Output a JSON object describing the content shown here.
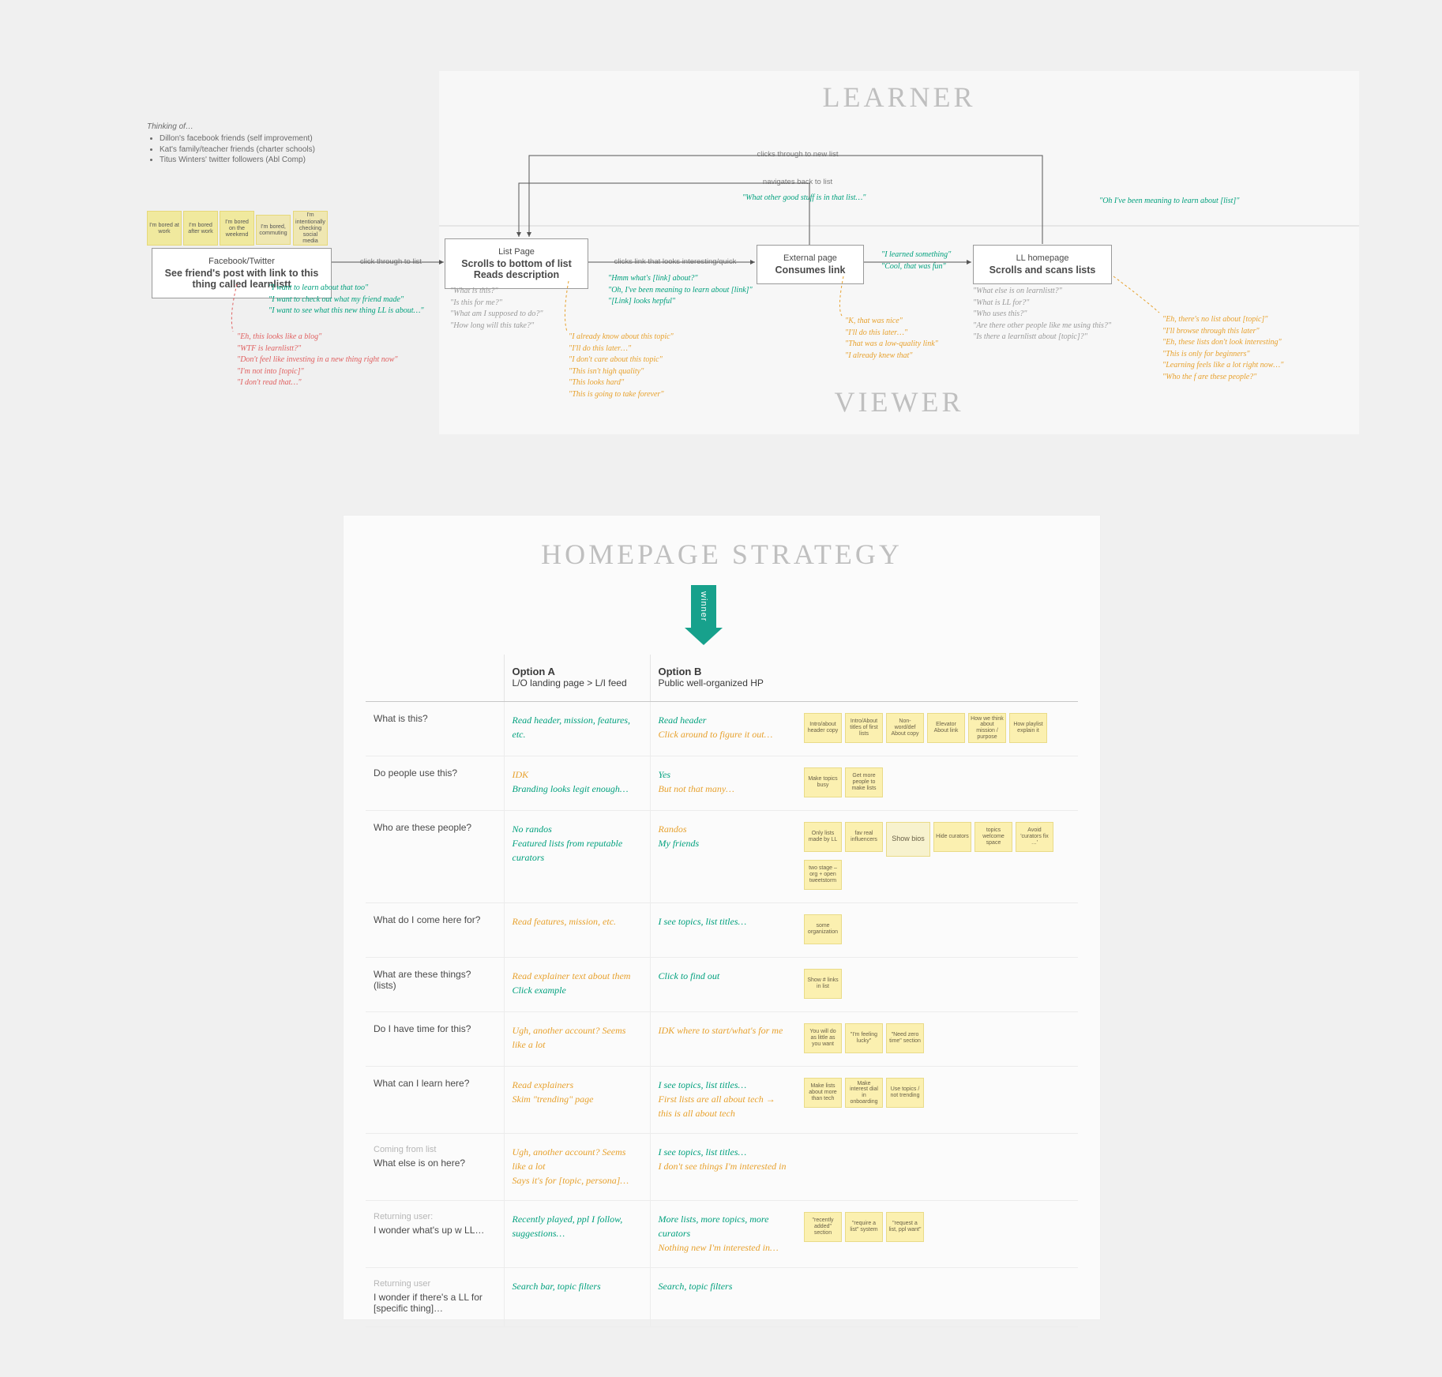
{
  "labels": {
    "learner": "LEARNER",
    "viewer": "Viewer",
    "strategy_title": "HOMEPAGE STRATEGY",
    "winner": "winner",
    "option_a": "Option A",
    "option_a_sub": "L/O landing page > L/I feed",
    "option_b": "Option B",
    "option_b_sub": "Public well-organized HP"
  },
  "thinking": {
    "head": "Thinking of…",
    "items": [
      "Dillon's facebook friends (self improvement)",
      "Kat's family/teacher friends (charter schools)",
      "Titus Winters' twitter followers (Abl Comp)"
    ]
  },
  "top_stickies": [
    "I'm bored at work",
    "I'm bored after work",
    "I'm bored on the weekend",
    "I'm bored, commuting",
    "I'm intentionally checking social media"
  ],
  "cards": {
    "fb": {
      "sub": "Facebook/Twitter",
      "title": "See friend's post with link to this thing called learnlistt"
    },
    "list": {
      "sub": "List Page",
      "title": "Scrolls to bottom of list\nReads description"
    },
    "ext": {
      "sub": "External page",
      "title": "Consumes link"
    },
    "hp": {
      "sub": "LL homepage",
      "title": "Scrolls and scans lists"
    }
  },
  "flow": {
    "click_list": "click through to list",
    "click_link": "clicks link that looks interesting/quick",
    "nav_back": "navigates back to list",
    "click_new": "clicks through to new list"
  },
  "quotes": {
    "fb_green": "\"I want to learn about that too\"\n\"I want to check out what my friend made\"\n\"I want to see what this new thing LL is about…\"",
    "fb_red": "\"Eh, this looks like a blog\"\n\"WTF is learnlistt?\"\n\"Don't feel like investing in a new thing right now\"\n\"I'm not into [topic]\"\n\"I don't read that…\"",
    "list_grey": "\"What is this?\"\n\"Is this for me?\"\n\"What am I supposed to do?\"\n\"How long will this take?\"",
    "list_green": "\"Hmm what's [link] about?\"\n\"Oh, I've been meaning to learn about [link]\"\n\"[Link] looks hepful\"",
    "list_orange": "\"I already know about this topic\"\n\"I'll do this later…\"\n\"I don't care about this topic\"\n\"This isn't high quality\"\n\"This looks hard\"\n\"This is going to take forever\"",
    "nav_green": "\"What other good stuff is in that list…\"",
    "ext_green_top": "\"I learned something\"\n\"Cool, that was fun\"",
    "ext_orange": "\"K, that was nice\"\n\"I'll do this later…\"\n\"That was a low-quality link\"\n\"I already knew that\"",
    "hp_green_intro": "\"Oh I've been meaning to learn about [list]\"",
    "hp_grey": "\"What else is on learnlistt?\"\n\"What is LL for?\"\n\"Who uses this?\"\n\"Are there other people like me using this?\"\n\"Is there a learnlistt about [topic]?\"",
    "hp_orange": "\"Eh, there's no list about [topic]\"\n\"I'll browse through this later\"\n\"Eh, these lists don't look interesting\"\n\"This is only for beginners\"\n\"Learning feels like a lot right now…\"\n\"Who the f are these people?\""
  },
  "strategy_rows": [
    {
      "question": "What is this?",
      "a": [
        [
          "green",
          "Read header, mission, features, etc."
        ]
      ],
      "b": [
        [
          "green",
          "Read header"
        ],
        [
          "orange",
          "Click around to figure it out…"
        ]
      ],
      "stickies": [
        "Intro/about header copy",
        "Intro/About titles of first lists",
        "Non-word/def About copy",
        "Elevator About link",
        "How we think about mission / purpose",
        "How playlist explain it"
      ]
    },
    {
      "question": "Do people use this?",
      "a": [
        [
          "orange",
          "IDK"
        ],
        [
          "green",
          "Branding looks legit enough…"
        ]
      ],
      "b": [
        [
          "green",
          "Yes"
        ],
        [
          "orange",
          "But not that many…"
        ]
      ],
      "stickies": [
        "Make topics busy",
        "Get more people to make lists"
      ]
    },
    {
      "question": "Who are these people?",
      "a": [
        [
          "green",
          "No randos"
        ],
        [
          "green",
          "Featured lists from reputable curators"
        ]
      ],
      "b": [
        [
          "orange",
          "Randos"
        ],
        [
          "green",
          "My friends"
        ]
      ],
      "stickies": [
        "Only lists made by LL",
        "fav real influencers",
        "Show bios",
        "Hide curators",
        "topics welcome space",
        "Avoid 'curators fix …'",
        "two stage – org + open tweetstorm"
      ]
    },
    {
      "question": "What do I come here for?",
      "a": [
        [
          "orange",
          "Read features, mission, etc."
        ]
      ],
      "b": [
        [
          "green",
          "I see topics, list titles…"
        ]
      ],
      "stickies": [
        "some organization"
      ]
    },
    {
      "question": "What are these things? (lists)",
      "a": [
        [
          "orange",
          "Read explainer text about them"
        ],
        [
          "green",
          "Click example"
        ]
      ],
      "b": [
        [
          "green",
          "Click to find out"
        ]
      ],
      "stickies": [
        "Show # links in list"
      ]
    },
    {
      "question": "Do I have time for this?",
      "a": [
        [
          "orange",
          "Ugh, another account? Seems like a lot"
        ]
      ],
      "b": [
        [
          "orange",
          "IDK where to start/what's for me"
        ]
      ],
      "stickies": [
        "You will do as little as you want",
        "\"I'm feeling lucky\"",
        "\"Need zero time\" section"
      ]
    },
    {
      "question": "What can I learn here?",
      "a": [
        [
          "orange",
          "Read explainers"
        ],
        [
          "orange",
          "Skim \"trending\" page"
        ]
      ],
      "b": [
        [
          "green",
          "I see topics, list titles…"
        ],
        [
          "orange",
          "First lists are all about tech → this is all about tech"
        ]
      ],
      "stickies": [
        "Make lists about more than tech",
        "Make interest dial in onboarding",
        "Use topics / not trending"
      ]
    },
    {
      "context": "Coming from list",
      "question": "What else is on here?",
      "a": [
        [
          "orange",
          "Ugh, another account? Seems like a lot"
        ],
        [
          "orange",
          "Says it's for [topic, persona]…"
        ]
      ],
      "b": [
        [
          "green",
          "I see topics, list titles…"
        ],
        [
          "orange",
          "I don't see things I'm interested in"
        ]
      ],
      "stickies": []
    },
    {
      "context": "Returning user:",
      "question": "I wonder what's up w LL…",
      "a": [
        [
          "green",
          "Recently played, ppl I follow, suggestions…"
        ]
      ],
      "b": [
        [
          "green",
          "More lists, more topics, more curators"
        ],
        [
          "orange",
          "Nothing new I'm interested in…"
        ]
      ],
      "stickies": [
        "\"recently added\" section",
        "\"require a list\" system",
        "\"request a list, ppl want\""
      ]
    },
    {
      "context": "Returning user",
      "question": "I wonder if there's a LL for [specific thing]…",
      "a": [
        [
          "green",
          "Search bar, topic filters"
        ]
      ],
      "b": [
        [
          "green",
          "Search, topic filters"
        ]
      ],
      "stickies": []
    }
  ]
}
